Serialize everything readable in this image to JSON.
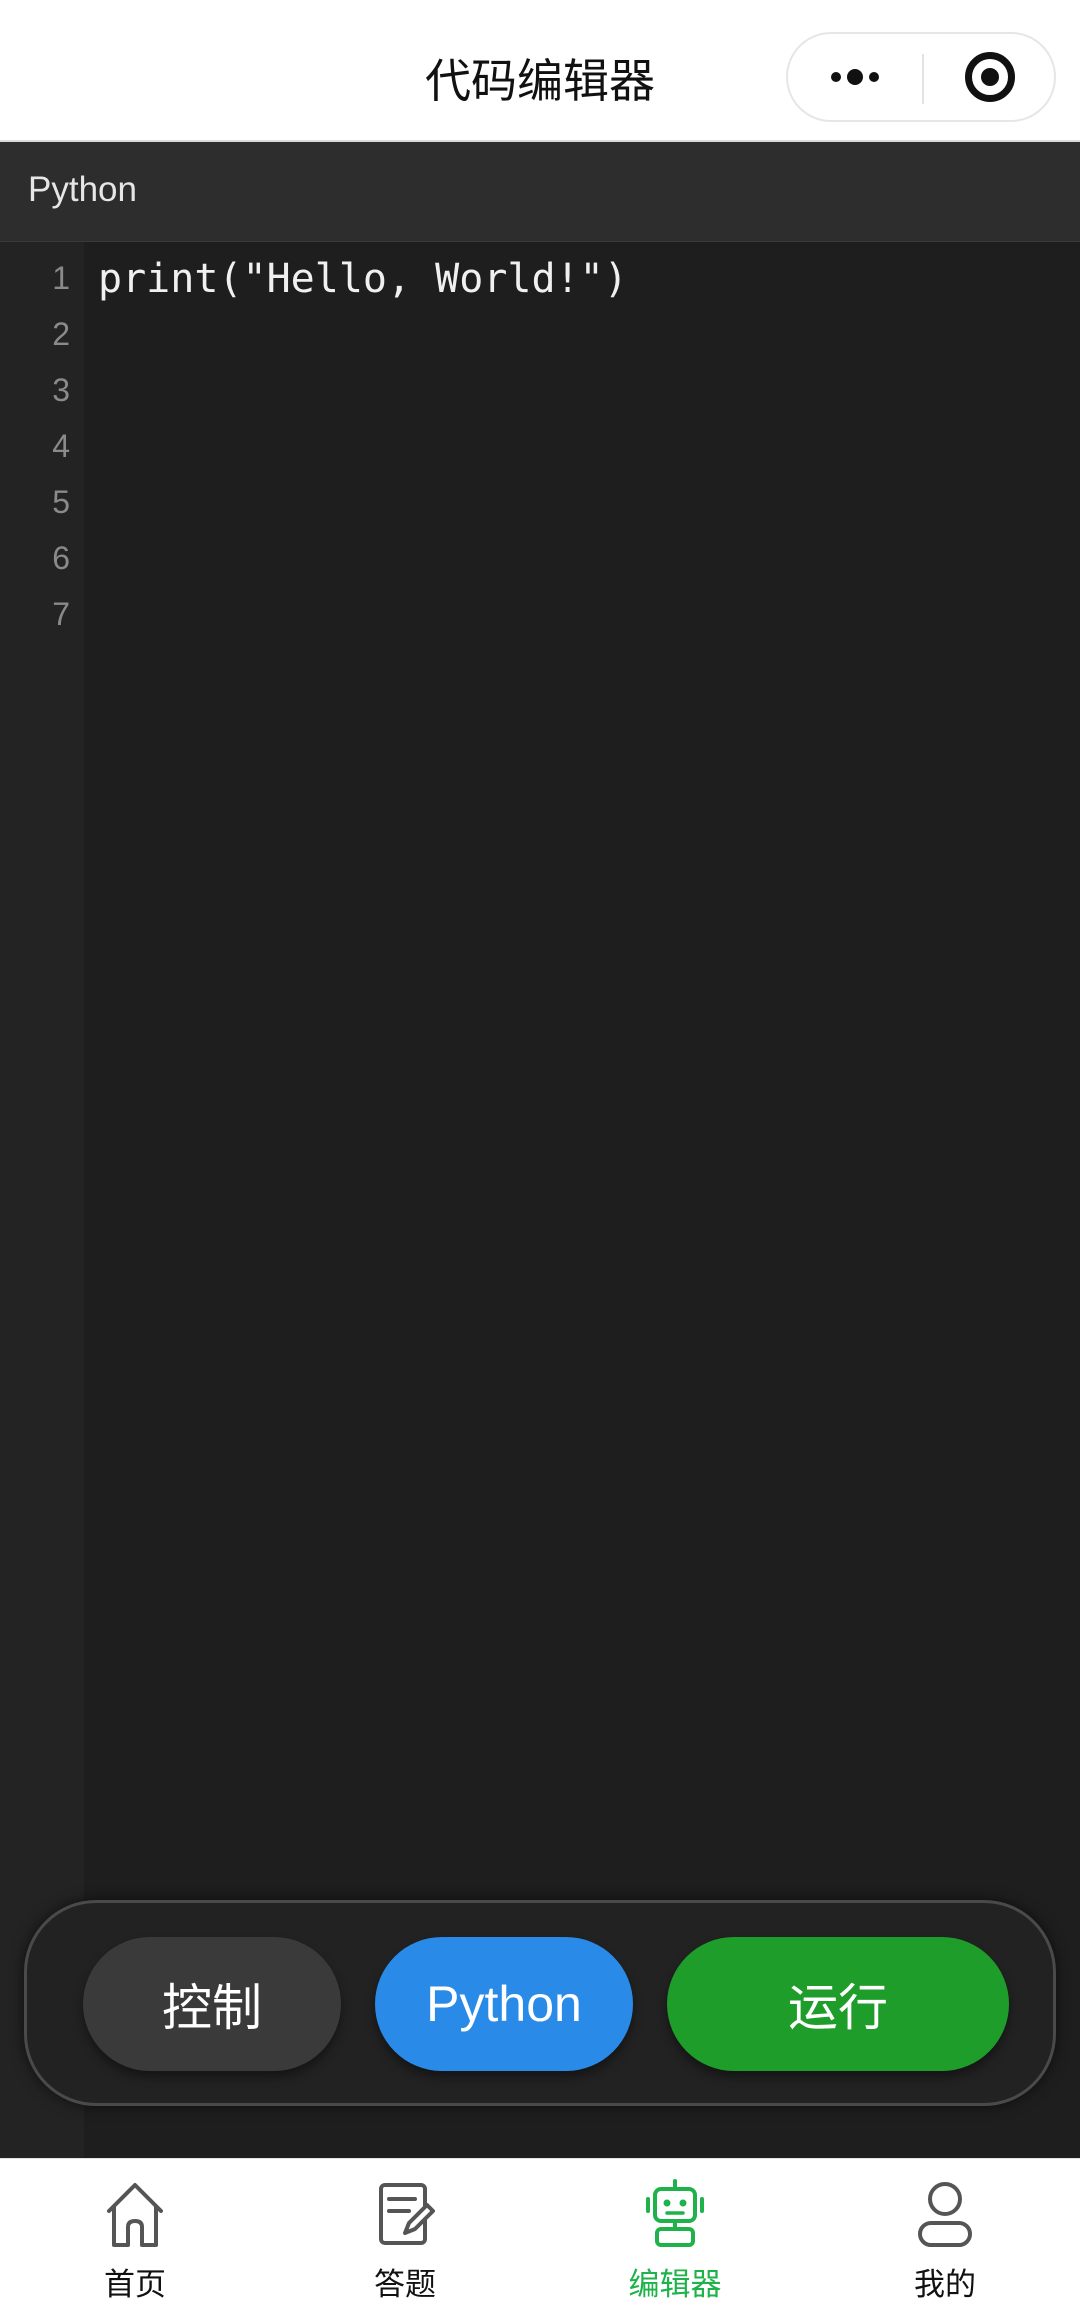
{
  "header": {
    "title": "代码编辑器",
    "more_icon": "more-dots-icon",
    "target_icon": "target-icon"
  },
  "language_bar": {
    "label": "Python"
  },
  "editor": {
    "line_numbers": [
      "1",
      "2",
      "3",
      "4",
      "5",
      "6",
      "7"
    ],
    "lines": [
      "print(\"Hello, World!\")",
      "",
      "",
      "",
      "",
      "",
      ""
    ]
  },
  "controls": {
    "control_label": "控制",
    "language_label": "Python",
    "run_label": "运行",
    "colors": {
      "control": "#3a3a3a",
      "language": "#2a8ae8",
      "run": "#1f9d2a"
    }
  },
  "tabbar": {
    "active_color": "#1fb24a",
    "items": [
      {
        "label": "首页",
        "icon": "home-icon",
        "active": false
      },
      {
        "label": "答题",
        "icon": "edit-icon",
        "active": false
      },
      {
        "label": "编辑器",
        "icon": "robot-icon",
        "active": true
      },
      {
        "label": "我的",
        "icon": "user-icon",
        "active": false
      }
    ]
  }
}
